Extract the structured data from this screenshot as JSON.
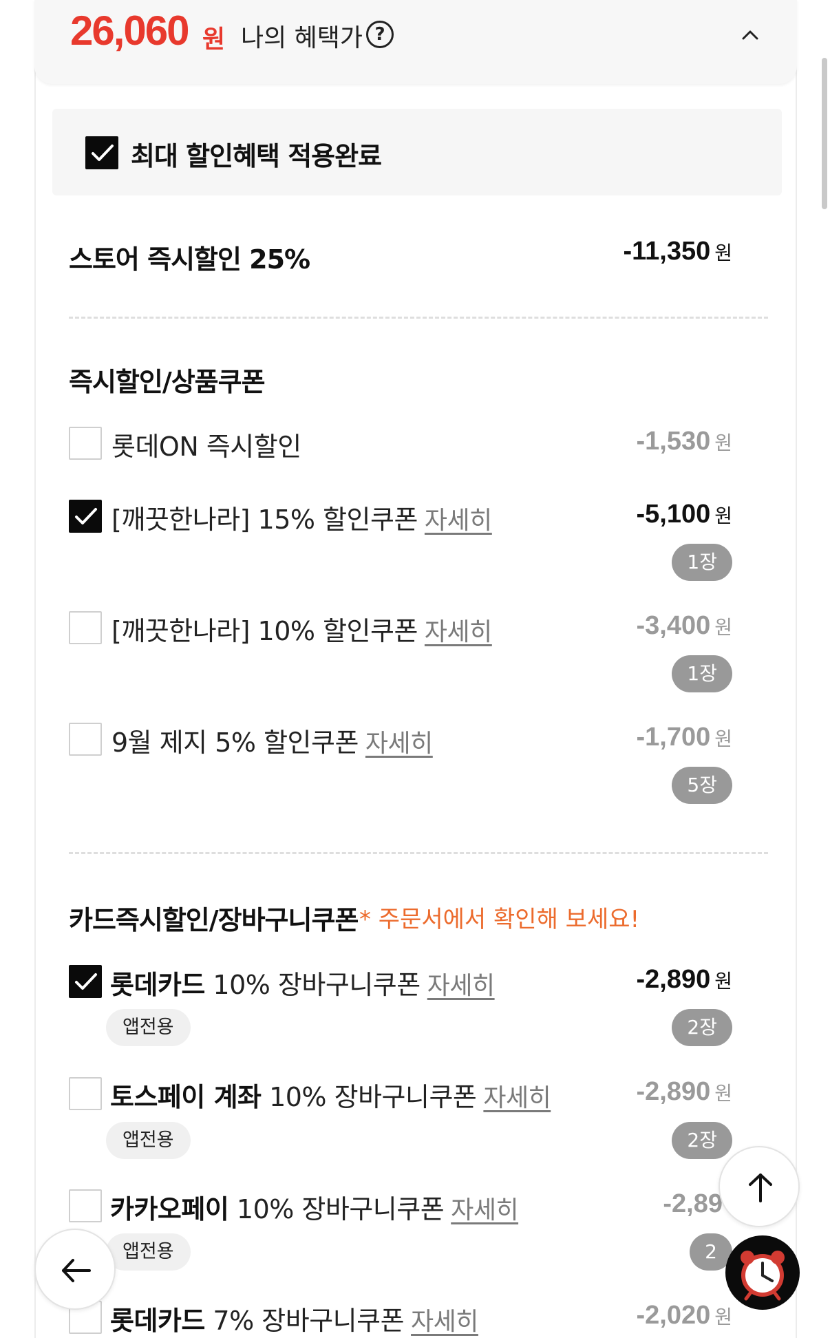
{
  "header": {
    "price": "26,060",
    "price_unit": "원",
    "benefit_label": "나의 혜택가",
    "help_glyph": "?"
  },
  "max_discount": {
    "label": "최대 할인혜택 적용완료",
    "checked": true
  },
  "store_discount": {
    "label": "스토어 즉시할인 25%",
    "amount": "-11,350",
    "unit": "원"
  },
  "instant_section": {
    "title": "즉시할인/상품쿠폰",
    "items": [
      {
        "label": "롯데ON 즉시할인",
        "link": "",
        "amount": "-1,530",
        "unit": "원",
        "count": "",
        "checked": false
      },
      {
        "label": "[깨끗한나라] 15% 할인쿠폰",
        "link": "자세히",
        "amount": "-5,100",
        "unit": "원",
        "count": "1장",
        "checked": true
      },
      {
        "label": "[깨끗한나라] 10% 할인쿠폰",
        "link": "자세히",
        "amount": "-3,400",
        "unit": "원",
        "count": "1장",
        "checked": false
      },
      {
        "label": "9월 제지 5% 할인쿠폰",
        "link": "자세히",
        "amount": "-1,700",
        "unit": "원",
        "count": "5장",
        "checked": false
      }
    ]
  },
  "card_section": {
    "title": "카드즉시할인/장바구니쿠폰",
    "note": "* 주문서에서 확인해 보세요!",
    "items": [
      {
        "bold": "롯데카드",
        "rest": " 10% 장바구니쿠폰",
        "link": "자세히",
        "amount": "-2,890",
        "unit": "원",
        "count": "2장",
        "tag": "앱전용",
        "checked": true
      },
      {
        "bold": "토스페이 계좌",
        "rest": " 10% 장바구니쿠폰",
        "link": "자세히",
        "amount": "-2,890",
        "unit": "원",
        "count": "2장",
        "tag": "앱전용",
        "checked": false
      },
      {
        "bold": "카카오페이",
        "rest": " 10% 장바구니쿠폰",
        "link": "자세히",
        "amount": "-2,89",
        "unit": "",
        "count": "2",
        "tag": "앱전용",
        "checked": false
      },
      {
        "bold": "롯데카드",
        "rest": " 7% 장바구니쿠폰",
        "link": "자세히",
        "amount": "-2,020",
        "unit": "원",
        "count": "",
        "tag": "",
        "checked": false
      }
    ]
  },
  "colors": {
    "price_red": "#e8392d",
    "note_orange": "#ec6b2d",
    "pill_gray": "#999999"
  },
  "icons": {
    "help": "question-circle-icon",
    "collapse": "chevron-up-icon",
    "scroll_top": "arrow-up-icon",
    "back": "arrow-left-icon",
    "alarm": "alarm-clock-icon"
  }
}
